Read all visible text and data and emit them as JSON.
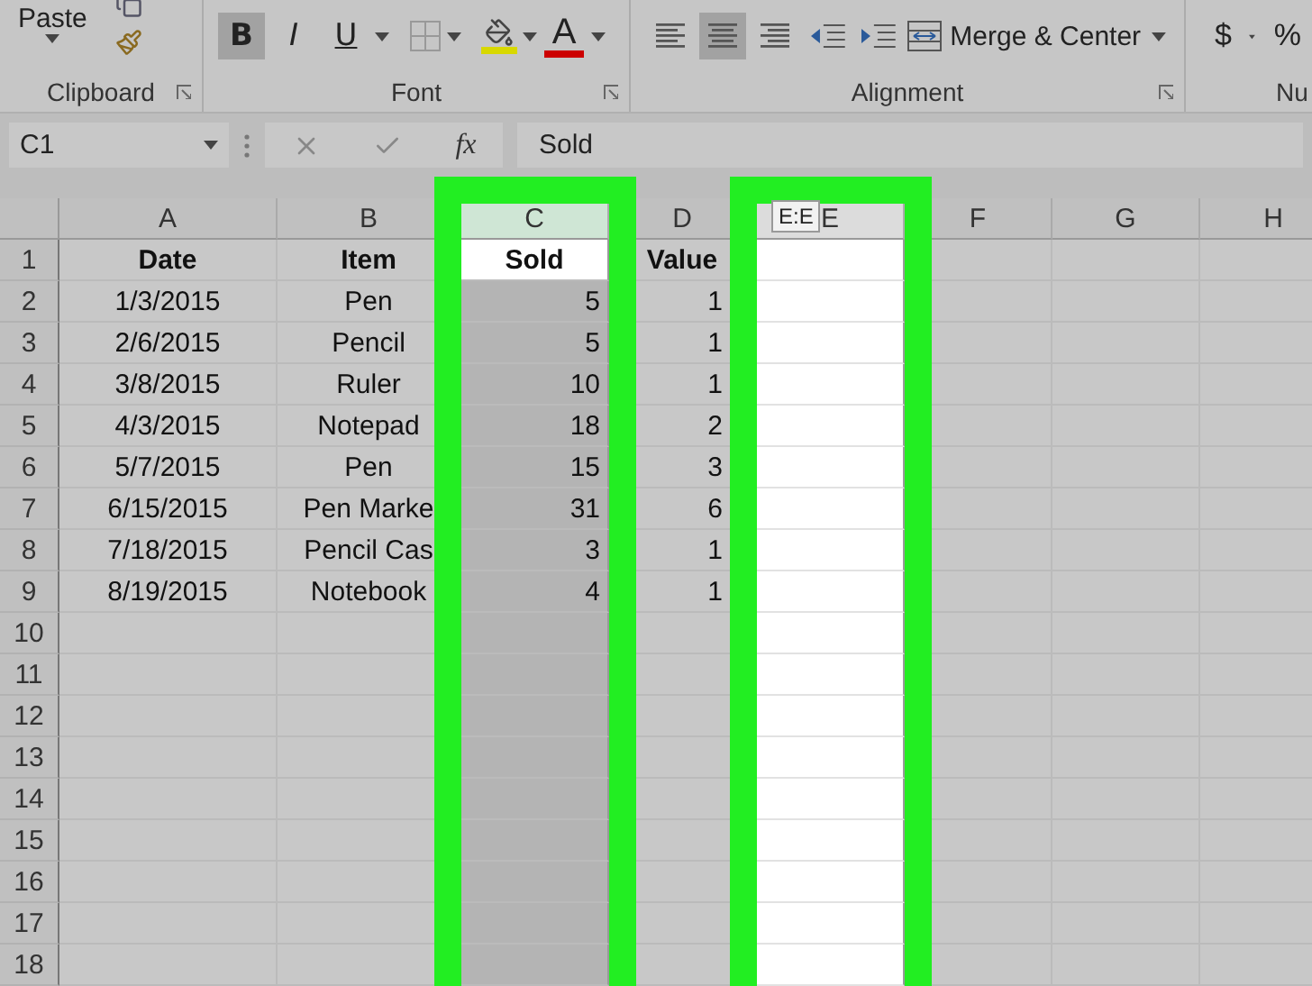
{
  "ribbon": {
    "clipboard": {
      "label": "Clipboard",
      "paste": "Paste"
    },
    "font": {
      "label": "Font",
      "bold": {
        "text": "B",
        "selected": true
      },
      "italic": {
        "text": "I",
        "selected": false
      },
      "underline": {
        "text": "U",
        "selected": false
      },
      "font_color": "A"
    },
    "alignment": {
      "label": "Alignment",
      "align": [
        {
          "selected": false
        },
        {
          "selected": true
        },
        {
          "selected": false
        }
      ],
      "merge": "Merge & Center"
    },
    "number": {
      "label": "Nu",
      "currency": "$",
      "percent": "%"
    }
  },
  "formula_bar": {
    "name_box": "C1",
    "fx": "fx",
    "value": "Sold"
  },
  "columns": [
    {
      "label": "A",
      "kind": "plain",
      "highlighted": false
    },
    {
      "label": "B",
      "kind": "plain",
      "highlighted": false
    },
    {
      "label": "C",
      "kind": "selected",
      "highlighted": true
    },
    {
      "label": "D",
      "kind": "plain",
      "highlighted": false
    },
    {
      "label": "E",
      "kind": "blank",
      "highlighted": true
    },
    {
      "label": "F",
      "kind": "plain",
      "highlighted": false
    },
    {
      "label": "G",
      "kind": "plain",
      "highlighted": false
    },
    {
      "label": "H",
      "kind": "plain",
      "highlighted": false
    }
  ],
  "column_tooltip": "E:E",
  "rows": [
    {
      "number": "1",
      "kind": "header",
      "cells": [
        {
          "text": "Date",
          "active": false
        },
        {
          "text": "Item",
          "active": false
        },
        {
          "text": "Sold",
          "active": true
        },
        {
          "text": "Value",
          "active": false
        }
      ]
    },
    {
      "number": "2",
      "kind": "data",
      "cells": [
        {
          "text": "1/3/2015",
          "active": false
        },
        {
          "text": "Pen",
          "active": false
        },
        {
          "text": "5",
          "active": false
        },
        {
          "text": "1",
          "active": false
        }
      ]
    },
    {
      "number": "3",
      "kind": "data",
      "cells": [
        {
          "text": "2/6/2015",
          "active": false
        },
        {
          "text": "Pencil",
          "active": false
        },
        {
          "text": "5",
          "active": false
        },
        {
          "text": "1",
          "active": false
        }
      ]
    },
    {
      "number": "4",
      "kind": "data",
      "cells": [
        {
          "text": "3/8/2015",
          "active": false
        },
        {
          "text": "Ruler",
          "active": false
        },
        {
          "text": "10",
          "active": false
        },
        {
          "text": "1",
          "active": false
        }
      ]
    },
    {
      "number": "5",
      "kind": "data",
      "cells": [
        {
          "text": "4/3/2015",
          "active": false
        },
        {
          "text": "Notepad",
          "active": false
        },
        {
          "text": "18",
          "active": false
        },
        {
          "text": "2",
          "active": false
        }
      ]
    },
    {
      "number": "6",
      "kind": "data",
      "cells": [
        {
          "text": "5/7/2015",
          "active": false
        },
        {
          "text": "Pen",
          "active": false
        },
        {
          "text": "15",
          "active": false
        },
        {
          "text": "3",
          "active": false
        }
      ]
    },
    {
      "number": "7",
      "kind": "data",
      "cells": [
        {
          "text": "6/15/2015",
          "active": false
        },
        {
          "text": "Pen Marke",
          "active": false
        },
        {
          "text": "31",
          "active": false
        },
        {
          "text": "6",
          "active": false
        }
      ]
    },
    {
      "number": "8",
      "kind": "data",
      "cells": [
        {
          "text": "7/18/2015",
          "active": false
        },
        {
          "text": "Pencil Cas",
          "active": false
        },
        {
          "text": "3",
          "active": false
        },
        {
          "text": "1",
          "active": false
        }
      ]
    },
    {
      "number": "9",
      "kind": "data",
      "cells": [
        {
          "text": "8/19/2015",
          "active": false
        },
        {
          "text": "Notebook",
          "active": false
        },
        {
          "text": "4",
          "active": false
        },
        {
          "text": "1",
          "active": false
        }
      ]
    },
    {
      "number": "10",
      "kind": "data"
    },
    {
      "number": "11",
      "kind": "data"
    },
    {
      "number": "12",
      "kind": "data"
    },
    {
      "number": "13",
      "kind": "data"
    },
    {
      "number": "14",
      "kind": "data"
    },
    {
      "number": "15",
      "kind": "data"
    },
    {
      "number": "16",
      "kind": "data"
    },
    {
      "number": "17",
      "kind": "data"
    },
    {
      "number": "18",
      "kind": "data"
    }
  ]
}
